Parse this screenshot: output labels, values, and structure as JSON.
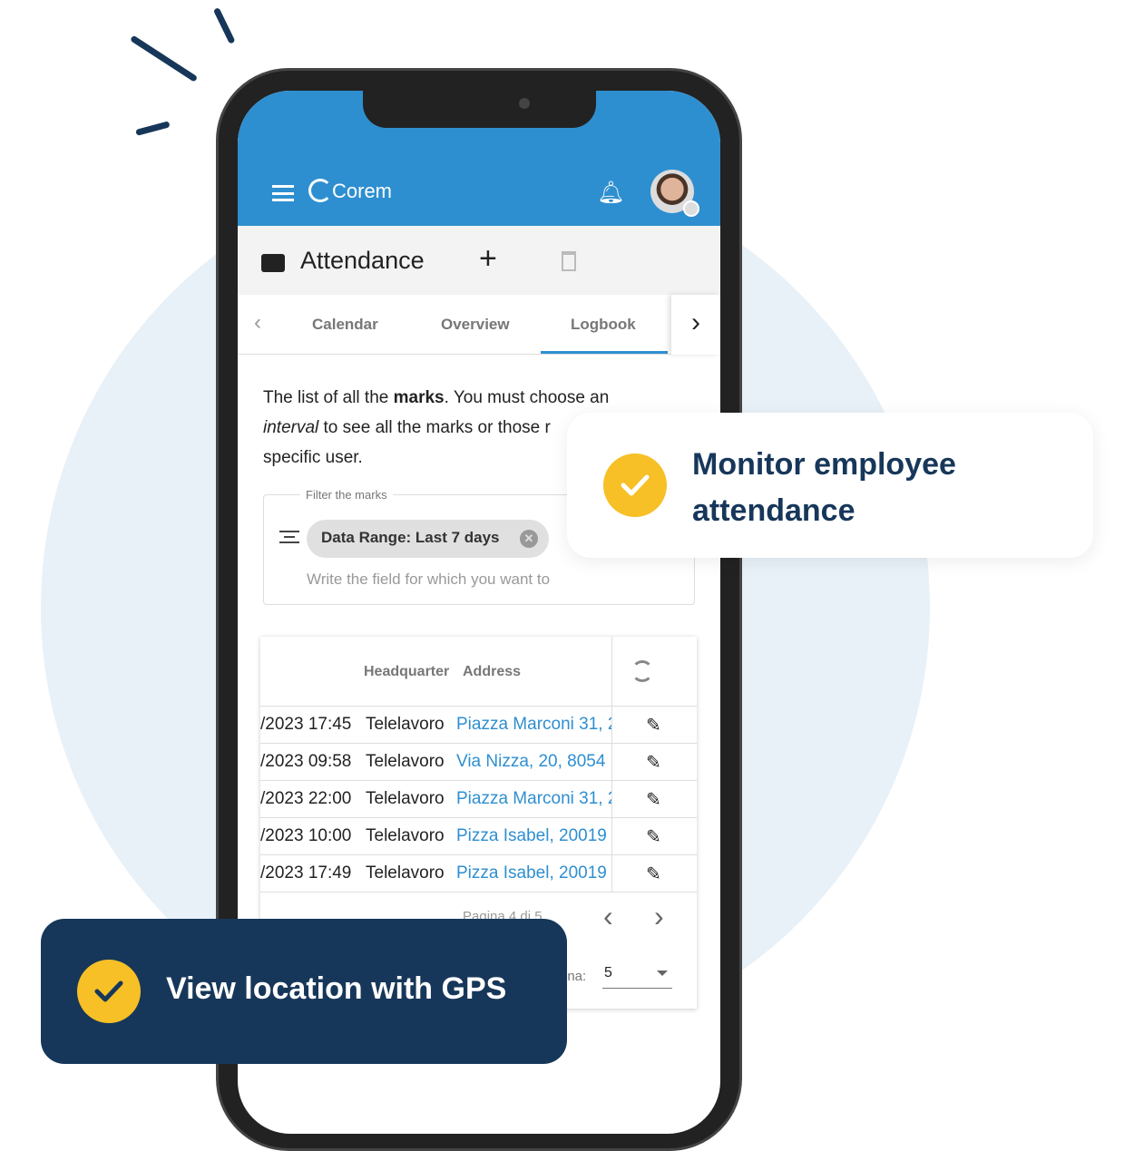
{
  "app": {
    "brand": "Corem",
    "page_title": "Attendance"
  },
  "tabs": [
    "Calendar",
    "Overview",
    "Logbook"
  ],
  "active_tab": "Logbook",
  "description": {
    "p1": "The list of all the ",
    "b": "marks",
    "p2": ". You must choose an ",
    "i": "interval",
    "p3": " to see all the marks or those r",
    "p4": "specific user."
  },
  "filter": {
    "legend": "Filter the marks",
    "chip": "Data Range: Last 7 days",
    "placeholder": "Write the field for which you want to"
  },
  "table": {
    "headers": [
      "Headquarter",
      "Address"
    ],
    "rows": [
      {
        "date": "/2023 17:45",
        "hq": "Telelavoro",
        "address": "Piazza Marconi 31, 2"
      },
      {
        "date": "/2023 09:58",
        "hq": "Telelavoro",
        "address": "Via Nizza, 20, 8054"
      },
      {
        "date": "/2023 22:00",
        "hq": "Telelavoro",
        "address": "Piazza Marconi 31, 2"
      },
      {
        "date": "/2023 10:00",
        "hq": "Telelavoro",
        "address": "Pizza Isabel, 20019"
      },
      {
        "date": "/2023 17:49",
        "hq": "Telelavoro",
        "address": "Pizza Isabel, 20019"
      }
    ],
    "pagination": "Pagina 4 di 5",
    "rows_label": "ina:",
    "rows_value": "5"
  },
  "cards": {
    "monitor": "Monitor employee attendance",
    "gps": "View location with GPS"
  },
  "colors": {
    "primary": "#2e8fd0",
    "navy": "#17375a",
    "accent": "#f6c026"
  }
}
